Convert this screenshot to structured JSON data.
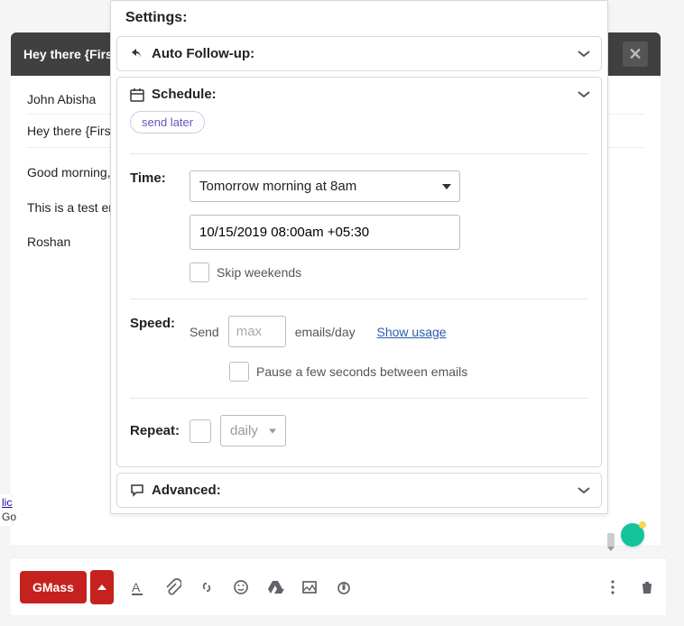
{
  "compose": {
    "subject_header": "Hey there {FirstName}",
    "to": "John Abisha",
    "subject": "Hey there {FirstName}",
    "line1": "Good morning,",
    "line2": "This is a test email.",
    "signature": "Roshan"
  },
  "panel": {
    "title": "Settings:",
    "autofollowup_label": "Auto Follow-up:",
    "schedule_label": "Schedule:",
    "send_later_badge": "send later",
    "time_label": "Time:",
    "time_select_value": "Tomorrow morning at 8am",
    "time_text_value": "10/15/2019 08:00am +05:30",
    "skip_weekends_label": "Skip weekends",
    "speed_label": "Speed:",
    "speed_send_label": "Send",
    "speed_max_placeholder": "max",
    "speed_emails_day_label": "emails/day",
    "show_usage_link": "Show usage",
    "pause_label": "Pause a few seconds between emails",
    "repeat_label": "Repeat:",
    "repeat_dropdown_value": "daily",
    "advanced_label": "Advanced:"
  },
  "toolbar": {
    "gmass_label": "GMass"
  }
}
